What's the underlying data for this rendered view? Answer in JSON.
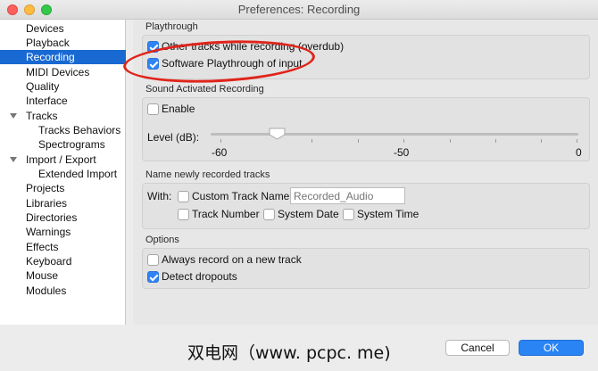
{
  "window": {
    "title": "Preferences: Recording"
  },
  "sidebar": {
    "items": [
      {
        "label": "Devices"
      },
      {
        "label": "Playback"
      },
      {
        "label": "Recording",
        "selected": true
      },
      {
        "label": "MIDI Devices"
      },
      {
        "label": "Quality"
      },
      {
        "label": "Interface"
      },
      {
        "label": "Tracks",
        "expanded": true
      },
      {
        "label": "Tracks Behaviors"
      },
      {
        "label": "Spectrograms"
      },
      {
        "label": "Import / Export",
        "expanded": true
      },
      {
        "label": "Extended Import"
      },
      {
        "label": "Projects"
      },
      {
        "label": "Libraries"
      },
      {
        "label": "Directories"
      },
      {
        "label": "Warnings"
      },
      {
        "label": "Effects"
      },
      {
        "label": "Keyboard"
      },
      {
        "label": "Mouse"
      },
      {
        "label": "Modules"
      }
    ]
  },
  "playthrough": {
    "title": "Playthrough",
    "overdub": {
      "label": "Other tracks while recording (overdub)",
      "checked": true
    },
    "software": {
      "label": "Software Playthrough of input",
      "checked": true
    }
  },
  "sound_activated": {
    "title": "Sound Activated Recording",
    "enable": {
      "label": "Enable",
      "checked": false
    },
    "level": {
      "label": "Level (dB):",
      "min_label": "-60",
      "mid_label": "-50",
      "max_label": "0",
      "min": -60,
      "max": 0,
      "value": -50
    }
  },
  "naming": {
    "title": "Name newly recorded tracks",
    "with_label": "With:",
    "custom_name": {
      "label": "Custom Track Name",
      "checked": false,
      "placeholder": "Recorded_Audio"
    },
    "track_number": {
      "label": "Track Number",
      "checked": false
    },
    "system_date": {
      "label": "System Date",
      "checked": false
    },
    "system_time": {
      "label": "System Time",
      "checked": false
    }
  },
  "options": {
    "title": "Options",
    "always_new_track": {
      "label": "Always record on a new track",
      "checked": false
    },
    "detect_dropouts": {
      "label": "Detect dropouts",
      "checked": true
    }
  },
  "buttons": {
    "cancel": "Cancel",
    "ok": "OK"
  },
  "watermark": "双电网（www. pcpc. me)",
  "colors": {
    "selection": "#1969d2",
    "accent": "#2a84f4",
    "annotation": "#e0241a"
  }
}
